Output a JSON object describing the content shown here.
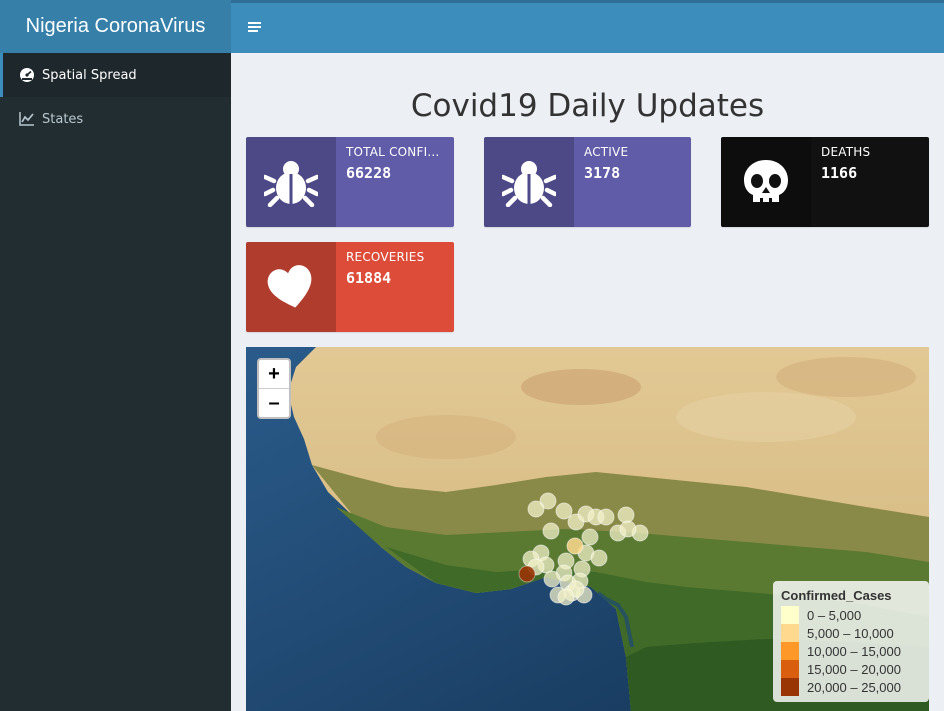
{
  "app": {
    "title": "Nigeria CoronaVirus"
  },
  "sidebar": {
    "items": [
      {
        "label": "Spatial Spread",
        "icon": "dashboard-icon",
        "active": true
      },
      {
        "label": "States",
        "icon": "line-chart-icon",
        "active": false
      }
    ]
  },
  "header": {
    "toggle_icon": "hamburger-icon"
  },
  "main": {
    "title": "Covid19 Daily Updates",
    "cards": [
      {
        "label": "TOTAL CONFI...",
        "value": "66228",
        "icon": "bug-icon",
        "color": "#605ca8"
      },
      {
        "label": "ACTIVE",
        "value": "3178",
        "icon": "bug-icon",
        "color": "#605ca8"
      },
      {
        "label": "DEATHS",
        "value": "1166",
        "icon": "skull-icon",
        "color": "#111111"
      },
      {
        "label": "RECOVERIES",
        "value": "61884",
        "icon": "heart-icon",
        "color": "#dd4b39"
      }
    ]
  },
  "map": {
    "zoom_in": "+",
    "zoom_out": "–",
    "legend": {
      "title": "Confirmed_Cases",
      "items": [
        {
          "label": "0 – 5,000",
          "color": "#ffffcc"
        },
        {
          "label": "5,000 – 10,000",
          "color": "#fed98e"
        },
        {
          "label": "10,000 – 15,000",
          "color": "#fe9929"
        },
        {
          "label": "15,000 – 20,000",
          "color": "#d95f0e"
        },
        {
          "label": "20,000 – 25,000",
          "color": "#993404"
        }
      ]
    }
  }
}
